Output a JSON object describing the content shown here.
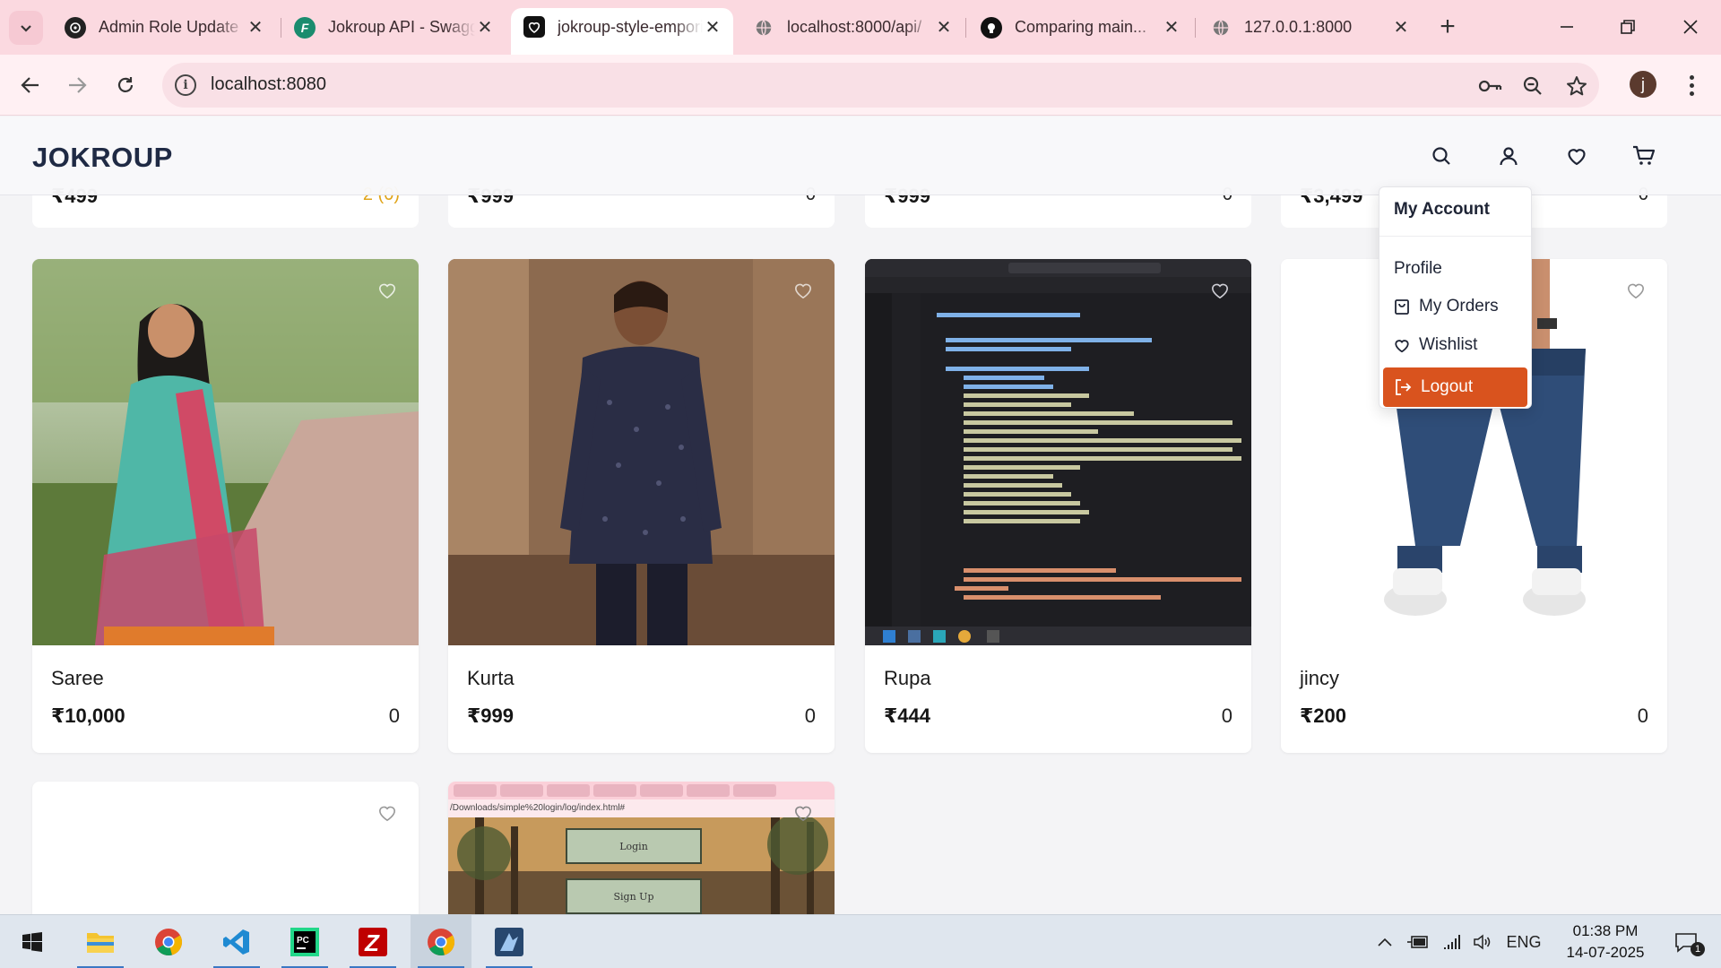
{
  "browser": {
    "tabs": [
      {
        "title": "Admin Role Update",
        "icon": "chatgpt-icon"
      },
      {
        "title": "Jokroup API - Swagger",
        "icon": "swagger-icon"
      },
      {
        "title": "jokroup-style-emporium",
        "icon": "heart-favicon",
        "active": true
      },
      {
        "title": "localhost:8000/api/",
        "icon": "globe-icon"
      },
      {
        "title": "Comparing main...",
        "icon": "github-icon"
      },
      {
        "title": "127.0.0.1:8000",
        "icon": "globe-icon"
      }
    ],
    "url": "localhost:8080",
    "profile_initial": "j"
  },
  "site": {
    "logo": "JOKROUP",
    "top_row": [
      {
        "price": "₹499",
        "rating": "2 (0)",
        "rating_color": "#e0a418"
      },
      {
        "price": "₹999",
        "rating": "0"
      },
      {
        "price": "₹999",
        "rating": "0"
      },
      {
        "price": "₹3,499",
        "rating": "0"
      }
    ],
    "products": [
      {
        "name": "Saree",
        "price": "₹10,000",
        "rating": "0"
      },
      {
        "name": "Kurta",
        "price": "₹999",
        "rating": "0"
      },
      {
        "name": "Rupa",
        "price": "₹444",
        "rating": "0"
      },
      {
        "name": "jincy",
        "price": "₹200",
        "rating": "0"
      }
    ],
    "bottom_row": [
      {
        "name": "",
        "price": ""
      },
      {
        "screenshot_buttons": [
          "Login",
          "Sign Up"
        ],
        "screenshot_path": "/Downloads/simple%20login/log/index.html#"
      }
    ],
    "account_menu": {
      "title": "My Account",
      "items": [
        "Profile",
        "My Orders",
        "Wishlist"
      ],
      "logout": "Logout",
      "logout_color": "#d9531e"
    }
  },
  "taskbar": {
    "apps": [
      "file-explorer-icon",
      "chrome-icon",
      "vscode-icon",
      "pycharm-icon",
      "filezilla-icon",
      "chrome-icon",
      "ssh-app-icon"
    ],
    "language": "ENG",
    "time": "01:38 PM",
    "date": "14-07-2025",
    "notifications": "1"
  }
}
